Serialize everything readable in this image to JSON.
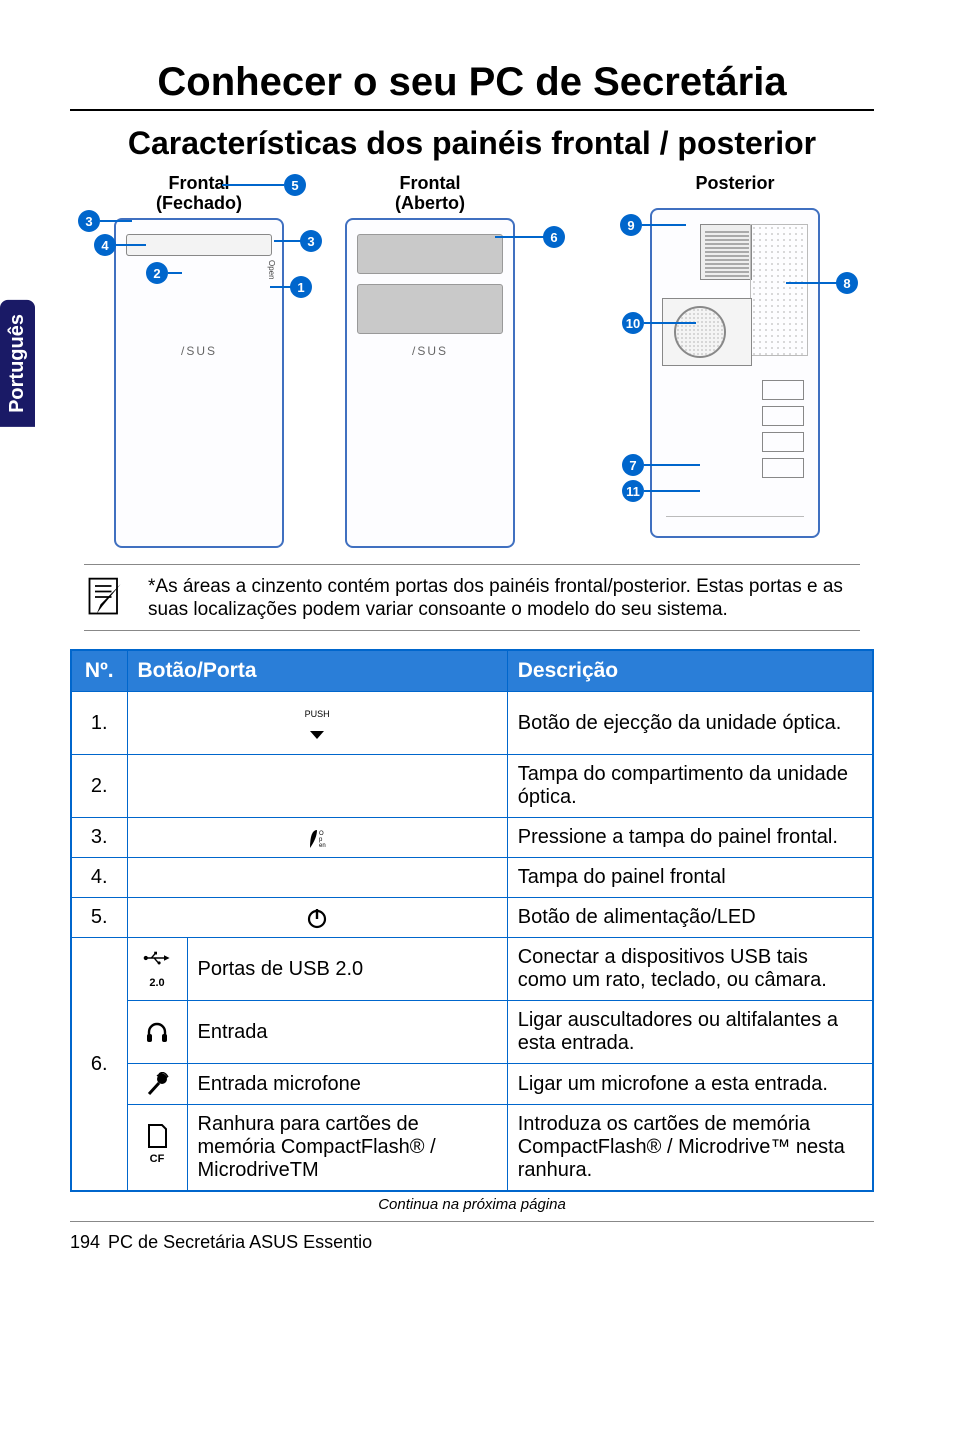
{
  "language_tab": "Português",
  "title": "Conhecer o seu PC de Secretária",
  "subtitle": "Características dos painéis frontal / posterior",
  "panels": {
    "front_closed": "Frontal\n(Fechado)",
    "front_open": "Frontal\n(Aberto)",
    "rear": "Posterior",
    "logo": "/SUS"
  },
  "callouts": {
    "n1": "1",
    "n2": "2",
    "n3": "3",
    "n4": "4",
    "n5": "5",
    "n6": "6",
    "n7": "7",
    "n8": "8",
    "n9": "9",
    "n10": "10",
    "n11": "11"
  },
  "note": "*As áreas a cinzento contém portas dos painéis frontal/posterior. Estas portas e as suas localizações podem variar consoante o modelo do seu sistema.",
  "table": {
    "headers": {
      "num": "Nº.",
      "btn": "Botão/Porta",
      "desc": "Descrição"
    },
    "r1": {
      "num": "1.",
      "btn_icon_label": "PUSH",
      "desc": "Botão de ejecção da unidade óptica."
    },
    "r2": {
      "num": "2.",
      "desc": "Tampa do compartimento da unidade óptica."
    },
    "r3": {
      "num": "3.",
      "desc": "Pressione a tampa do painel frontal."
    },
    "r4": {
      "num": "4.",
      "desc": "Tampa do painel frontal"
    },
    "r5": {
      "num": "5.",
      "desc": "Botão de alimentação/LED"
    },
    "r6": {
      "num": "6.",
      "usb_badge": "2.0",
      "usb_label": "Portas de USB 2.0",
      "usb_desc": "Conectar a dispositivos USB tais como um rato, teclado, ou câmara.",
      "hp_label": "Entrada",
      "hp_desc": "Ligar auscultadores ou altifalantes a esta entrada.",
      "mic_label": "Entrada microfone",
      "mic_desc": "Ligar um microfone a esta entrada.",
      "cf_badge": "CF",
      "cf_label": "Ranhura para cartões de memória CompactFlash® / MicrodriveTM",
      "cf_desc": "Introduza os cartões de memória CompactFlash® / Microdrive™ nesta ranhura."
    }
  },
  "continued": "Continua na próxima página",
  "footer": {
    "page": "194",
    "product": "PC de Secretária ASUS Essentio"
  }
}
